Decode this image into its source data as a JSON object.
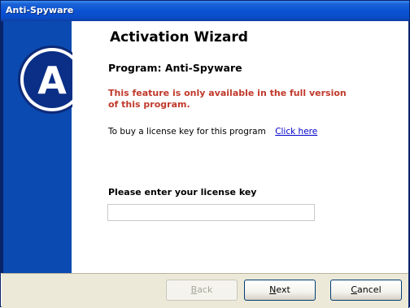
{
  "window": {
    "title": "Anti-Spyware"
  },
  "wizard": {
    "title": "Activation Wizard",
    "program_label": "Program: Anti-Spyware",
    "notice": "This feature is only available in the full version of this program.",
    "buy_text": "To buy a license key for this program",
    "buy_link": "Click here",
    "license_label": "Please enter your license key",
    "license_value": ""
  },
  "buttons": {
    "back": {
      "first": "B",
      "rest": "ack",
      "enabled": false
    },
    "next": {
      "first": "N",
      "rest": "ext",
      "enabled": true
    },
    "cancel": {
      "first": "C",
      "rest": "ancel",
      "enabled": true
    }
  },
  "logo": {
    "letter": "A",
    "icon": "anti-spyware-logo-icon"
  },
  "colors": {
    "titlebar": "#0a52d3",
    "side_panel": "#0b4ab0",
    "notice_text": "#c0392b",
    "link": "#0000cc",
    "footer": "#ece9d8"
  }
}
